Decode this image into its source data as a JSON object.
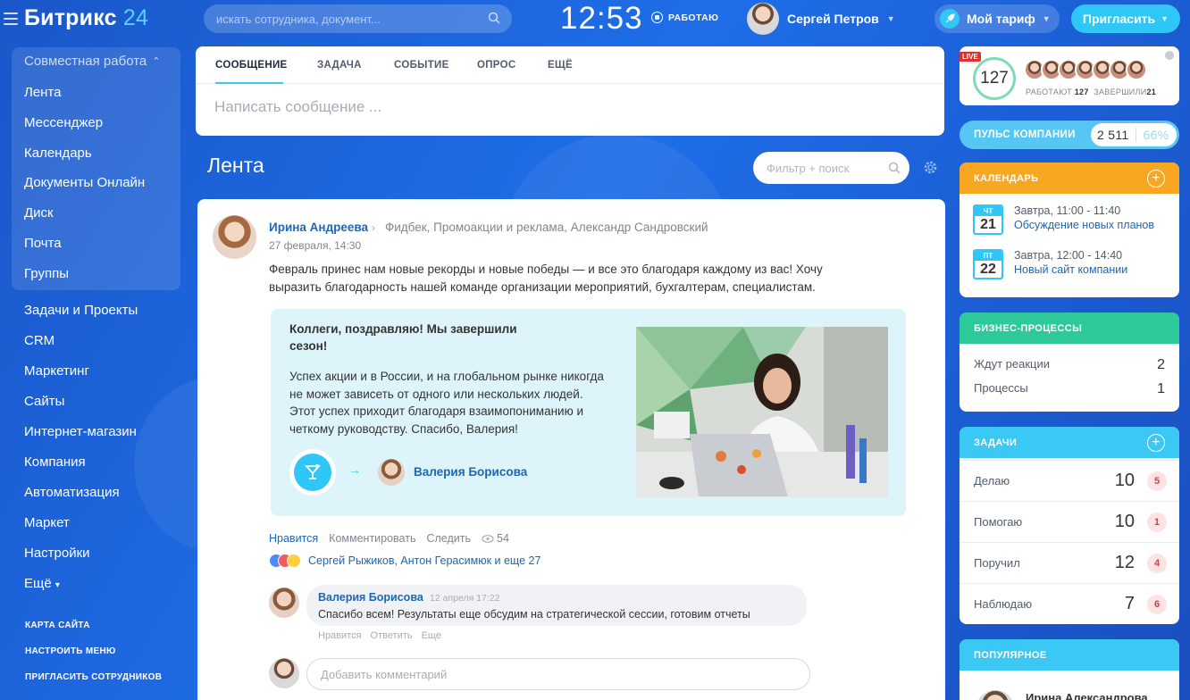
{
  "header": {
    "logo_main": "Битрикс",
    "logo_num": "24",
    "search_placeholder": "искать сотрудника, документ...",
    "clock": "12:53",
    "work_status": "РАБОТАЮ",
    "user_name": "Сергей Петров",
    "tariff_label": "Мой тариф",
    "invite_label": "Пригласить"
  },
  "sidebar": {
    "group_title": "Совместная работа",
    "group_items": [
      "Лента",
      "Мессенджер",
      "Календарь",
      "Документы Онлайн",
      "Диск",
      "Почта",
      "Группы"
    ],
    "items": [
      "Задачи и Проекты",
      "CRM",
      "Маркетинг",
      "Сайты",
      "Интернет-магазин",
      "Компания",
      "Автоматизация",
      "Маркет",
      "Настройки",
      "Ещё"
    ],
    "footer_links": [
      "КАРТА САЙТА",
      "НАСТРОИТЬ МЕНЮ",
      "ПРИГЛАСИТЬ СОТРУДНИКОВ"
    ]
  },
  "composer": {
    "tabs": [
      "СООБЩЕНИЕ",
      "ЗАДАЧА",
      "СОБЫТИЕ",
      "ОПРОС",
      "ЕЩЁ"
    ],
    "active_tab": "СООБЩЕНИЕ",
    "placeholder": "Написать сообщение ..."
  },
  "feed": {
    "title": "Лента",
    "filter_placeholder": "Фильтр + поиск"
  },
  "post": {
    "author": "Ирина Андреева",
    "recipients": "Фидбек, Промоакции и реклама, Александр Сандровский",
    "date": "27 февраля, 14:30",
    "text": "Февраль принес нам новые рекорды и новые победы — и все это благодаря каждому из вас! Хочу выразить благодарность нашей команде организации мероприятий, бухгалтерам, специалистам.",
    "card_title": "Коллеги, поздравляю! Мы завершили сезон!",
    "card_body": "Успех акции и в России, и на глобальном рынке никогда не может зависеть от одного или нескольких людей. Этот успех приходит благодаря взаимопониманию и четкому руководству. Спасибо, Валерия!",
    "card_person": "Валерия Борисова",
    "actions": {
      "like": "Нравится",
      "comment": "Комментировать",
      "follow": "Следить",
      "views": "54"
    },
    "likers": "Сергей Рыжиков, Антон Герасимюк и еще 27",
    "comment": {
      "author": "Валерия Борисова",
      "date": "12 апреля 17:22",
      "text": "Спасибо всем! Результаты еще обсудим на стратегической сессии, готовим отчеты",
      "actions": [
        "Нравится",
        "Ответить",
        "Еще"
      ]
    },
    "add_comment_placeholder": "Добавить комментарий"
  },
  "right": {
    "live_badge": "LIVE",
    "online_count": "127",
    "working_label": "РАБОТАЮТ",
    "working_count": "127",
    "finished_label": "ЗАВЕРШИЛИ",
    "finished_count": "21",
    "pulse_label": "ПУЛЬС КОМПАНИИ",
    "pulse_value": "2 511",
    "pulse_percent": "66%",
    "calendar_title": "КАЛЕНДАРЬ",
    "calendar_events": [
      {
        "dow": "ЧТ",
        "day": "21",
        "time": "Завтра, 11:00 - 11:40",
        "title": "Обсуждение новых планов"
      },
      {
        "dow": "ПТ",
        "day": "22",
        "time": "Завтра, 12:00 - 14:40",
        "title": "Новый сайт компании"
      }
    ],
    "bp_title": "БИЗНЕС-ПРОЦЕССЫ",
    "bp_rows": [
      {
        "label": "Ждут реакции",
        "value": "2"
      },
      {
        "label": "Процессы",
        "value": "1"
      }
    ],
    "tasks_title": "ЗАДАЧИ",
    "tasks_rows": [
      {
        "label": "Делаю",
        "value": "10",
        "badge": "5"
      },
      {
        "label": "Помогаю",
        "value": "10",
        "badge": "1"
      },
      {
        "label": "Поручил",
        "value": "12",
        "badge": "4"
      },
      {
        "label": "Наблюдаю",
        "value": "7",
        "badge": "6"
      }
    ],
    "popular_title": "ПОПУЛЯРНОЕ",
    "popular_name": "Ирина Александрова"
  },
  "colors": {
    "accent": "#2fc7f7",
    "calendar": "#f7a721",
    "bp": "#2dc99b",
    "tasks": "#3bc8f5",
    "link": "#2067b0"
  }
}
